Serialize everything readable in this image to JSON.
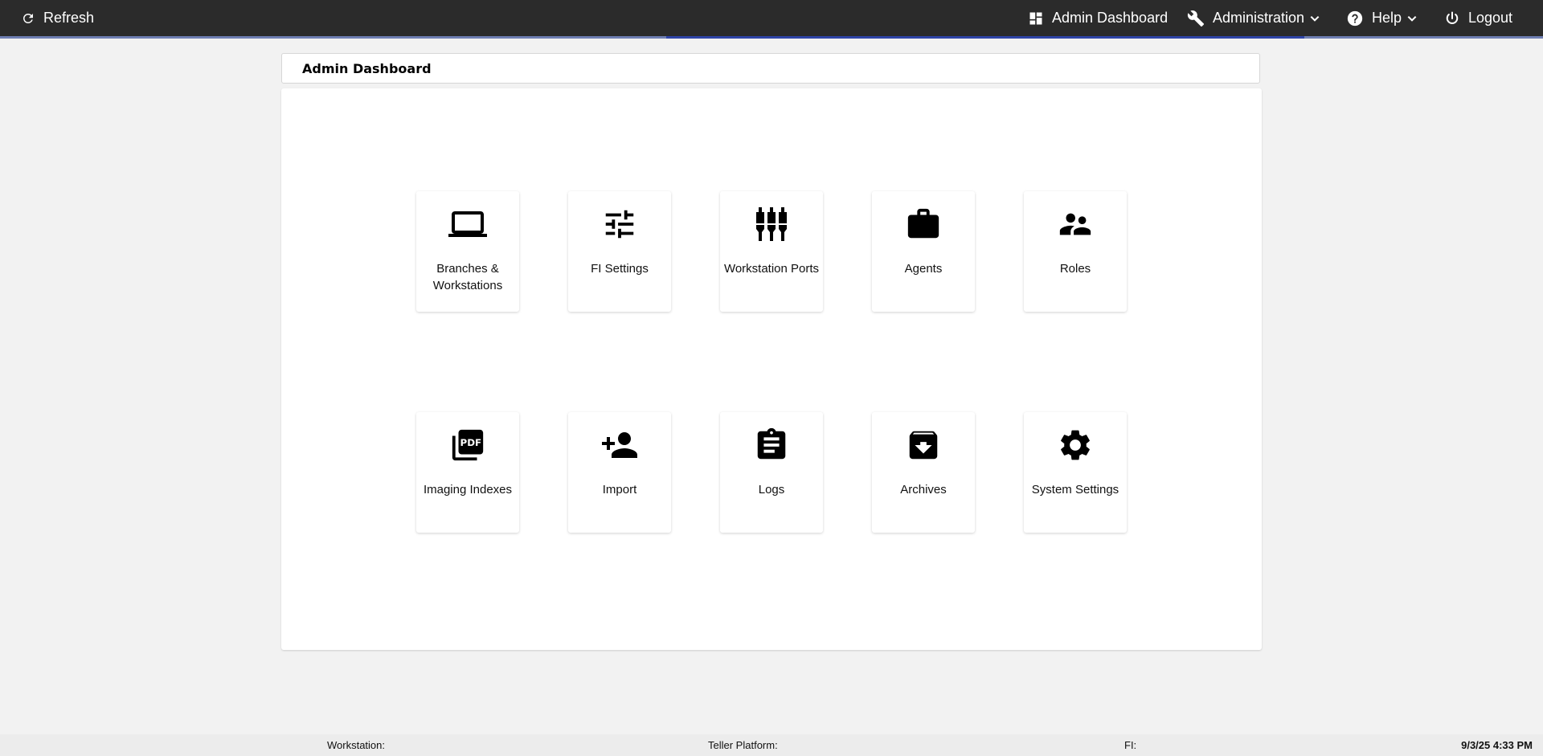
{
  "topbar": {
    "refresh_label": "Refresh",
    "refresh_icon": "refresh-icon",
    "nav": [
      {
        "label": "Admin Dashboard",
        "icon": "dashboard-icon"
      },
      {
        "label": "Administration",
        "icon": "wrench-icon"
      },
      {
        "label": "Help",
        "icon": "help-circle-icon"
      },
      {
        "label": "Logout",
        "icon": "power-icon"
      }
    ],
    "background_color": "#2b2b2b",
    "active_underline_color": "#2f45a8"
  },
  "header": {
    "title": "Admin Dashboard"
  },
  "tiles": [
    {
      "label": "Branches & Workstations",
      "icon": "laptop-icon"
    },
    {
      "label": "FI Settings",
      "icon": "tune-sliders-icon"
    },
    {
      "label": "Workstation Ports",
      "icon": "cable-ports-icon"
    },
    {
      "label": "Agents",
      "icon": "briefcase-icon"
    },
    {
      "label": "Roles",
      "icon": "people-icon"
    },
    {
      "label": "Imaging Indexes",
      "icon": "pdf-icon"
    },
    {
      "label": "Import",
      "icon": "person-add-icon"
    },
    {
      "label": "Logs",
      "icon": "clipboard-icon"
    },
    {
      "label": "Archives",
      "icon": "archive-box-icon"
    },
    {
      "label": "System Settings",
      "icon": "gear-icon"
    }
  ],
  "footer": {
    "workstation_label": "Workstation:",
    "teller_platform_label": "Teller Platform:",
    "fi_label": "FI:",
    "datetime": "9/3/25 4:33 PM"
  }
}
